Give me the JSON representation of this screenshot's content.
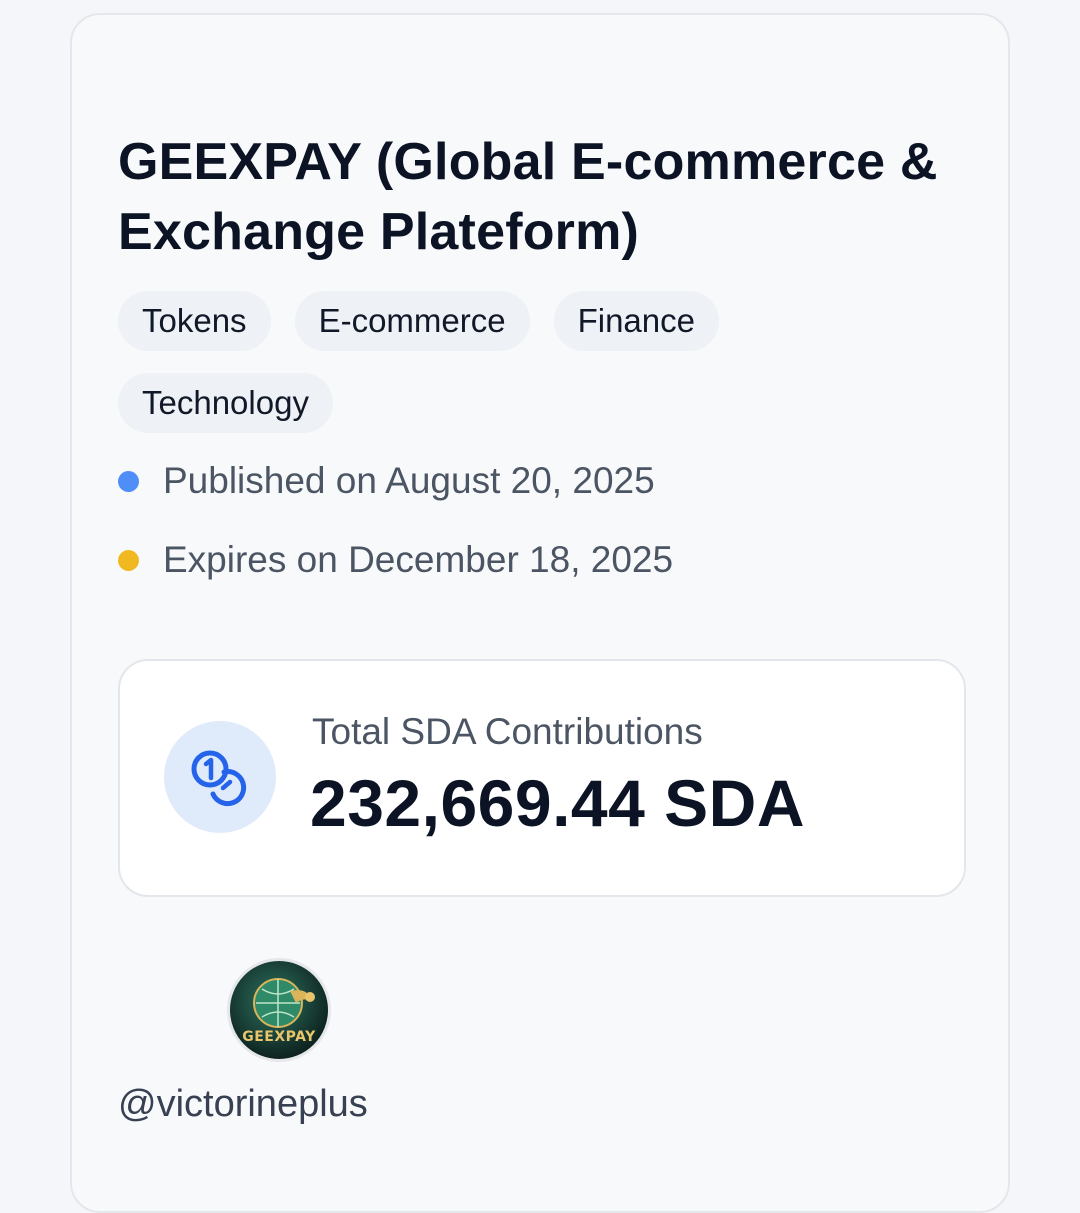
{
  "card": {
    "title": "GEEXPAY (Global E-commerce & Exchange Plateform)",
    "tags": [
      "Tokens",
      "E-commerce",
      "Finance",
      "Technology"
    ],
    "published": {
      "text": "Published on August 20, 2025",
      "dot_color": "#4f8ef7"
    },
    "expires": {
      "text": "Expires on December 18, 2025",
      "dot_color": "#f0b922"
    },
    "stats": {
      "label": "Total SDA Contributions",
      "value": "232,669.44 SDA",
      "icon": "coins-icon",
      "icon_color": "#2563eb",
      "icon_bg": "#dfeafb"
    },
    "author": {
      "avatar_text": "GEEXPAY",
      "handle": "@victorineplus"
    }
  }
}
